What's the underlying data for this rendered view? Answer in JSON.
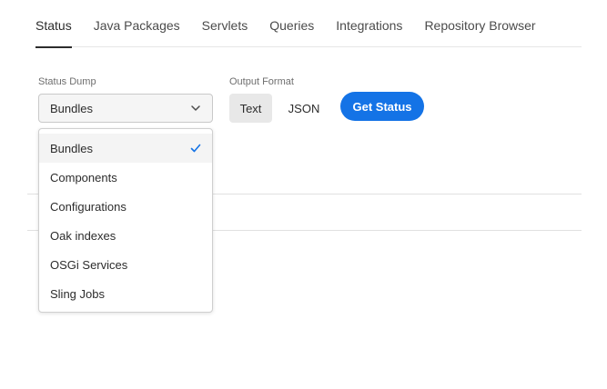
{
  "tabs": [
    {
      "label": "Status",
      "active": true
    },
    {
      "label": "Java Packages"
    },
    {
      "label": "Servlets"
    },
    {
      "label": "Queries"
    },
    {
      "label": "Integrations"
    },
    {
      "label": "Repository Browser"
    }
  ],
  "status_dump": {
    "label": "Status Dump",
    "selected": "Bundles",
    "options": [
      "Bundles",
      "Components",
      "Configurations",
      "Oak indexes",
      "OSGi Services",
      "Sling Jobs"
    ]
  },
  "output_format": {
    "label": "Output Format",
    "options": [
      "Text",
      "JSON"
    ],
    "selected": "Text"
  },
  "get_status_label": "Get Status",
  "colors": {
    "accent": "#1473e6",
    "selected_segment": "#e8e8e8"
  }
}
